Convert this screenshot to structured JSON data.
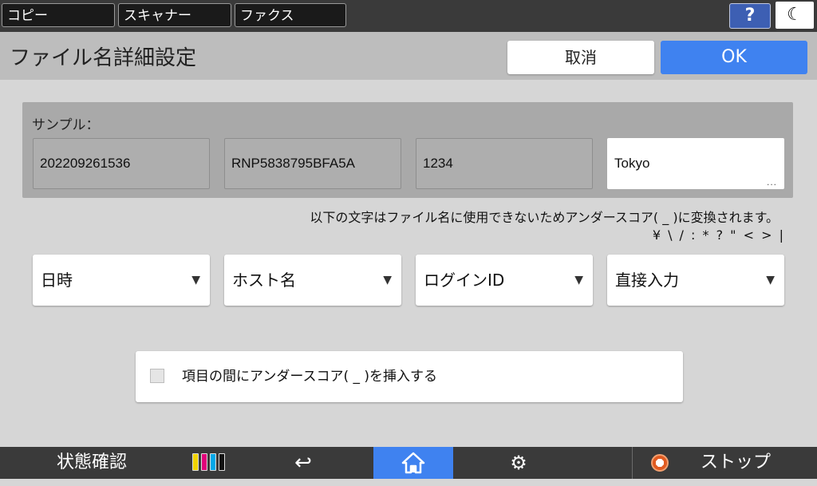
{
  "colors": {
    "accent": "#3f82f0",
    "help": "#3d5fb3",
    "stop": "#e05a20"
  },
  "top_tabs": [
    "コピー",
    "スキャナー",
    "ファクス"
  ],
  "top_right": {
    "help_label": "?",
    "night_icon": "moon-icon"
  },
  "header": {
    "title": "ファイル名詳細設定",
    "cancel_label": "取消",
    "ok_label": "OK"
  },
  "sample": {
    "label": "サンプル：",
    "fields": [
      "202209261536",
      "RNP5838795BFA5A",
      "1234",
      "Tokyo"
    ],
    "more_icon": "..."
  },
  "notice": {
    "line1": "以下の文字はファイル名に使用できないためアンダースコア( _ )に変換されます。",
    "line2": "¥ \\ / : * ? \" < > |"
  },
  "dropdowns": [
    {
      "label": "日時"
    },
    {
      "label": "ホスト名"
    },
    {
      "label": "ログインID"
    },
    {
      "label": "直接入力"
    }
  ],
  "dropdown_arrow": "▼",
  "underscore_option": {
    "label": "項目の間にアンダースコア( _ )を挿入する",
    "checked": false
  },
  "bottom_bar": {
    "status_label": "状態確認",
    "ink_colors": [
      "#f2d400",
      "#e0007a",
      "#00a8e8",
      "#111111"
    ],
    "back_icon": "↩",
    "home_icon": "home-icon",
    "settings_icon": "⚙",
    "stop_label": "ストップ"
  }
}
